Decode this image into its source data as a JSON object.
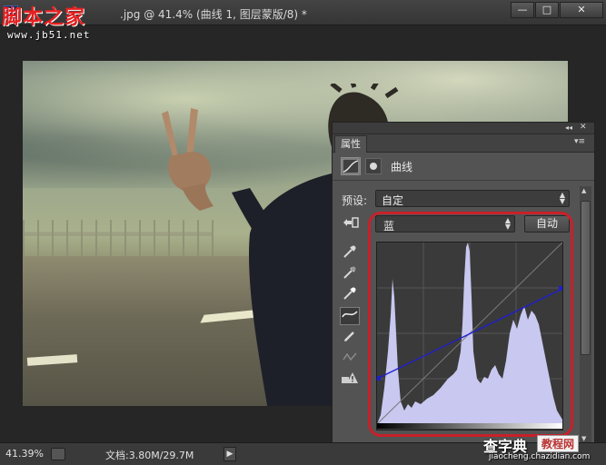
{
  "window": {
    "app_icon": "P",
    "title": "脚本之家…加…A…).jpg @ 41.4% (曲线 1, 图层蒙版/8) *",
    "title_visible": ".jpg @ 41.4% (曲线 1, 图层蒙版/8) *",
    "min_label": "—",
    "max_label": "□",
    "close_label": "✕"
  },
  "watermark": {
    "site_name": "脚本之家",
    "site_url": "www.jb51.net",
    "bottom_name": "查字典",
    "bottom_box": "教程网",
    "bottom_url": "jiaocheng.chazidian.com"
  },
  "statusbar": {
    "zoom": "41.39%",
    "doc_size": "文档:3.80M/29.7M",
    "arrow": "▶"
  },
  "panel": {
    "collapse_label": "◂◂",
    "close_label": "✕",
    "tab": "属性",
    "menu_icon": "▾≡",
    "adjustment_title": "曲线",
    "preset_label": "预设:",
    "preset_value": "自定",
    "channel_value": "蓝",
    "auto_label": "自动",
    "icons": [
      "curves-adjustment-icon",
      "layer-mask-icon",
      "on-image-hand-icon",
      "black-point-eyedropper-icon",
      "gray-point-eyedropper-icon",
      "white-point-eyedropper-icon",
      "curve-edit-icon",
      "pencil-icon",
      "smooth-icon",
      "clipping-warning-icon"
    ]
  },
  "curve": {
    "channel": "blue",
    "points": [
      [
        0,
        64
      ],
      [
        255,
        190
      ]
    ],
    "histogram_color": "#c9c8f0",
    "curve_color": "#1f1fd0"
  },
  "colors": {
    "highlight": "#c8202a",
    "panel_bg": "#535353"
  }
}
